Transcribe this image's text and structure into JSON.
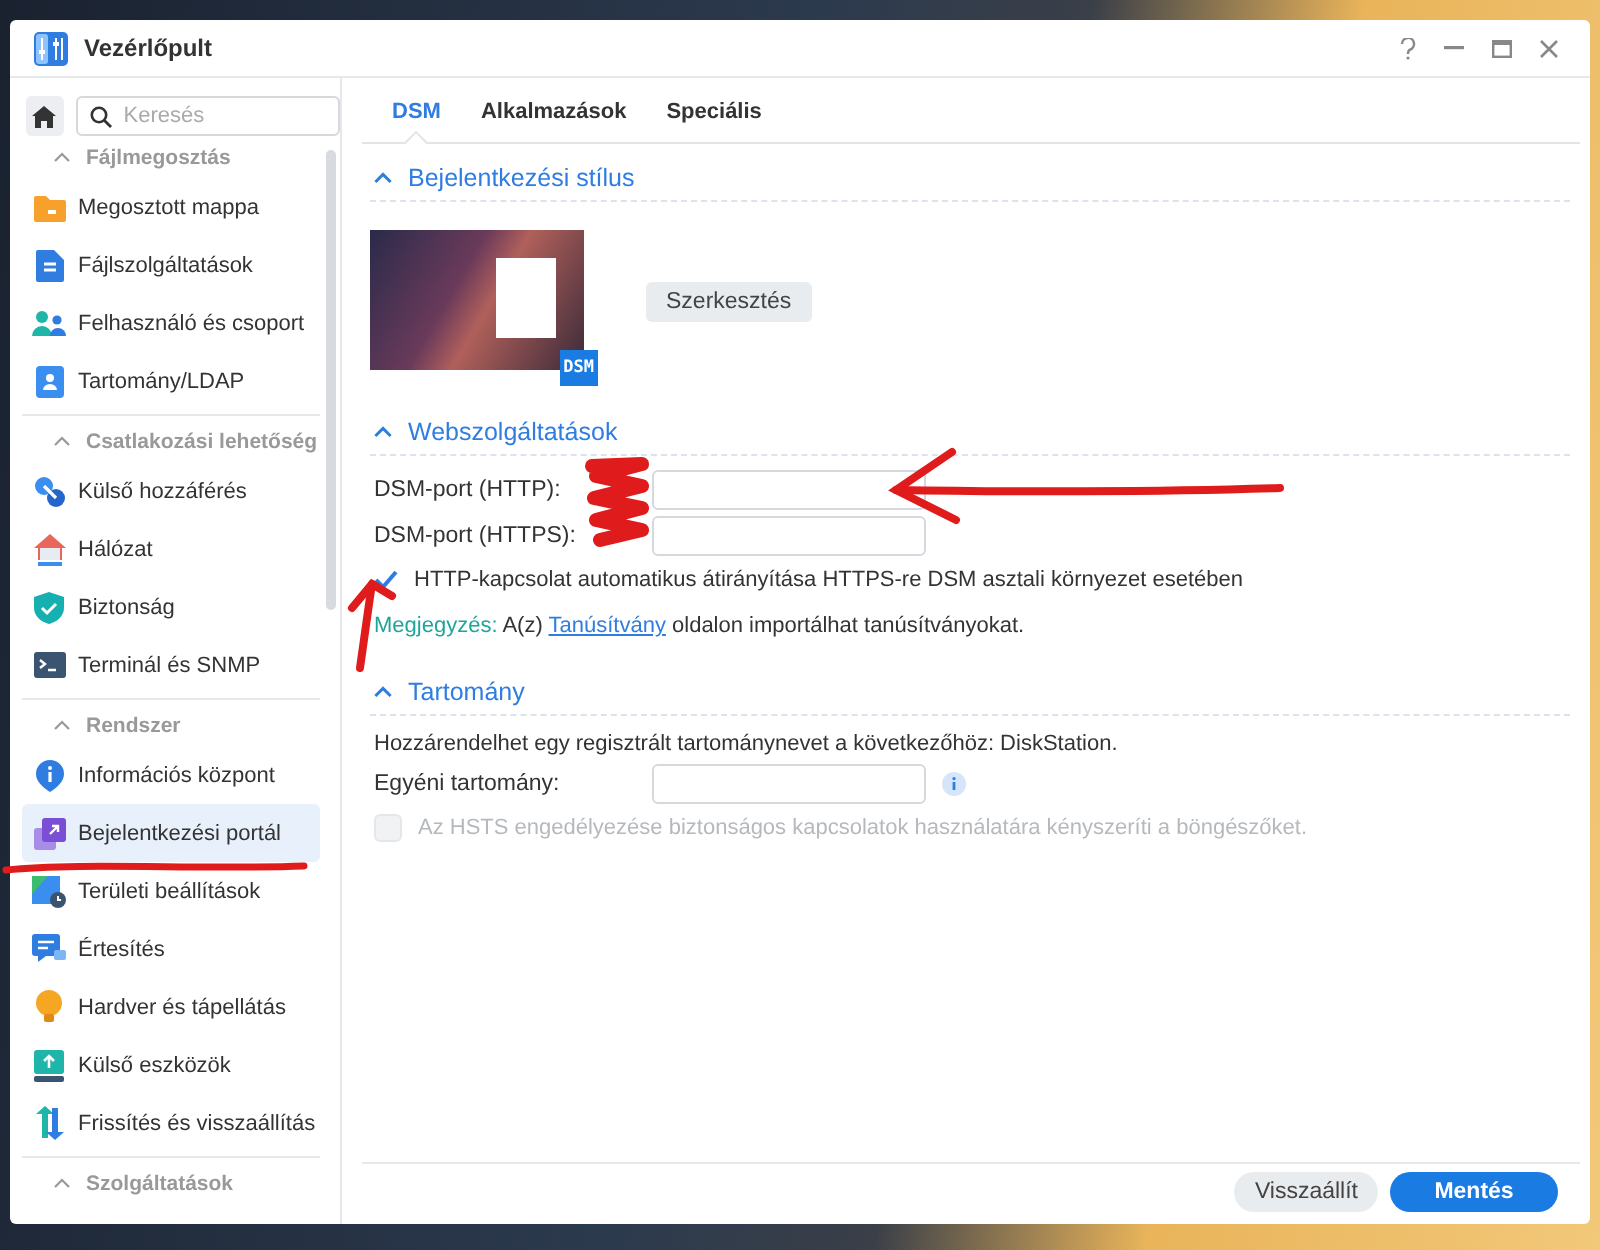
{
  "window": {
    "title": "Vezérlőpult"
  },
  "sidebar": {
    "search": {
      "placeholder": "Keresés"
    },
    "groups": [
      {
        "label": "Fájlmegosztás",
        "expanded": true,
        "items": [
          {
            "label": "Megosztott mappa",
            "selected": false
          },
          {
            "label": "Fájlszolgáltatások",
            "selected": false
          },
          {
            "label": "Felhasználó és csoport",
            "selected": false
          },
          {
            "label": "Tartomány/LDAP",
            "selected": false
          }
        ]
      },
      {
        "label": "Csatlakozási lehetőség",
        "expanded": true,
        "items": [
          {
            "label": "Külső hozzáférés",
            "selected": false
          },
          {
            "label": "Hálózat",
            "selected": false
          },
          {
            "label": "Biztonság",
            "selected": false
          },
          {
            "label": "Terminál és SNMP",
            "selected": false
          }
        ]
      },
      {
        "label": "Rendszer",
        "expanded": true,
        "items": [
          {
            "label": "Információs központ",
            "selected": false
          },
          {
            "label": "Bejelentkezési portál",
            "selected": true
          },
          {
            "label": "Területi beállítások",
            "selected": false
          },
          {
            "label": "Értesítés",
            "selected": false
          },
          {
            "label": "Hardver és tápellátás",
            "selected": false
          },
          {
            "label": "Külső eszközök",
            "selected": false
          },
          {
            "label": "Frissítés és visszaállítás",
            "selected": false
          }
        ]
      },
      {
        "label": "Szolgáltatások",
        "expanded": true
      }
    ]
  },
  "tabs": [
    {
      "label": "DSM",
      "selected": true
    },
    {
      "label": "Alkalmazások",
      "selected": false
    },
    {
      "label": "Speciális",
      "selected": false
    }
  ],
  "login_style": {
    "title": "Bejelentkezési stílus",
    "expanded": true,
    "preview_badge": "DSM",
    "edit_button": "Szerkesztés"
  },
  "web_services": {
    "title": "Webszolgáltatások",
    "expanded": true,
    "fields": [
      {
        "label": "DSM-port (HTTP):"
      },
      {
        "label": "DSM-port (HTTPS):"
      }
    ],
    "redirect": {
      "label": "HTTP-kapcsolat automatikus átirányítása HTTPS-re DSM asztali környezet esetében",
      "checked": true
    },
    "note": {
      "prefix": "Megjegyzés:",
      "before": "A(z)",
      "link": "Tanúsítvány",
      "after": "oldalon importálhat tanúsítványokat."
    }
  },
  "domain": {
    "title": "Tartomány",
    "expanded": true,
    "description": "Hozzárendelhet egy regisztrált tartománynevet a következőhöz: DiskStation.",
    "field": {
      "label": "Egyéni tartomány:"
    },
    "hsts": {
      "label": "Az HSTS engedélyezése biztonságos kapcsolatok használatára kényszeríti a böngészőket.",
      "checked": false,
      "disabled": true
    }
  },
  "footer": {
    "buttons": [
      {
        "label": "Visszaállít",
        "kind": "secondary"
      },
      {
        "label": "Mentés",
        "kind": "primary"
      }
    ]
  }
}
